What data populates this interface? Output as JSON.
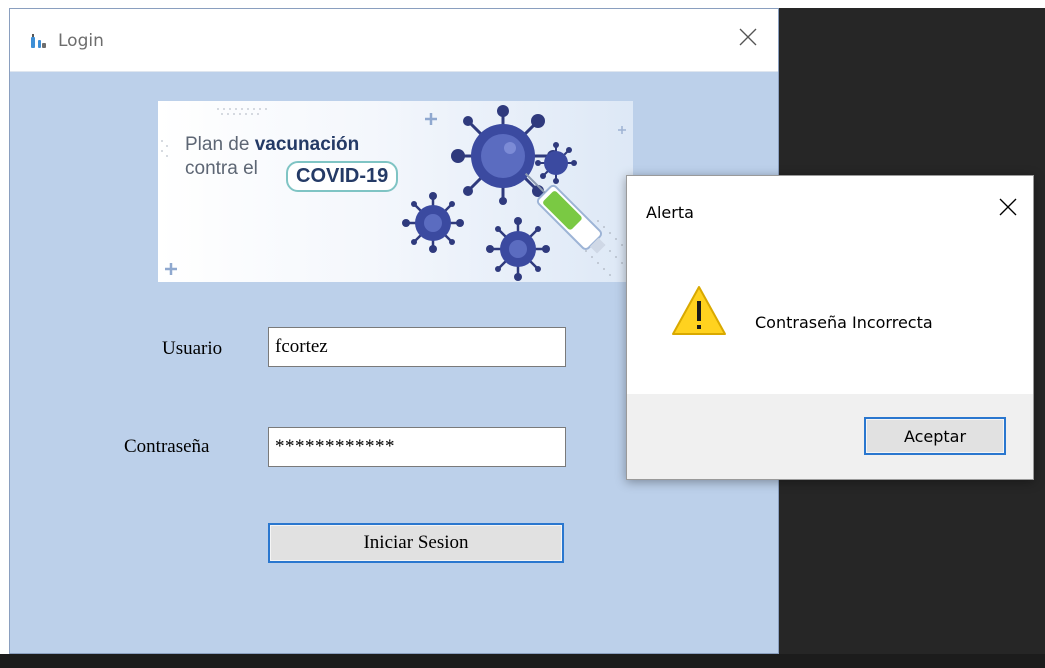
{
  "login_window": {
    "title": "Login",
    "app_icon": "vaccine-icon",
    "close_icon": "close-icon",
    "background": "#bcd0ea",
    "banner": {
      "line1": "Plan de",
      "line1_bold": "vacunación",
      "line2": "contra el",
      "line2_bold": "COVID-19"
    },
    "form": {
      "username_label": "Usuario",
      "username_value": "fcortez",
      "password_label": "Contraseña",
      "password_value": "************",
      "submit_label": "Iniciar Sesion"
    }
  },
  "alert_dialog": {
    "title": "Alerta",
    "message": "Contraseña Incorrecta",
    "icon": "warning-icon",
    "close_icon": "close-icon",
    "ok_label": "Aceptar",
    "accent": "#2a77cf"
  }
}
